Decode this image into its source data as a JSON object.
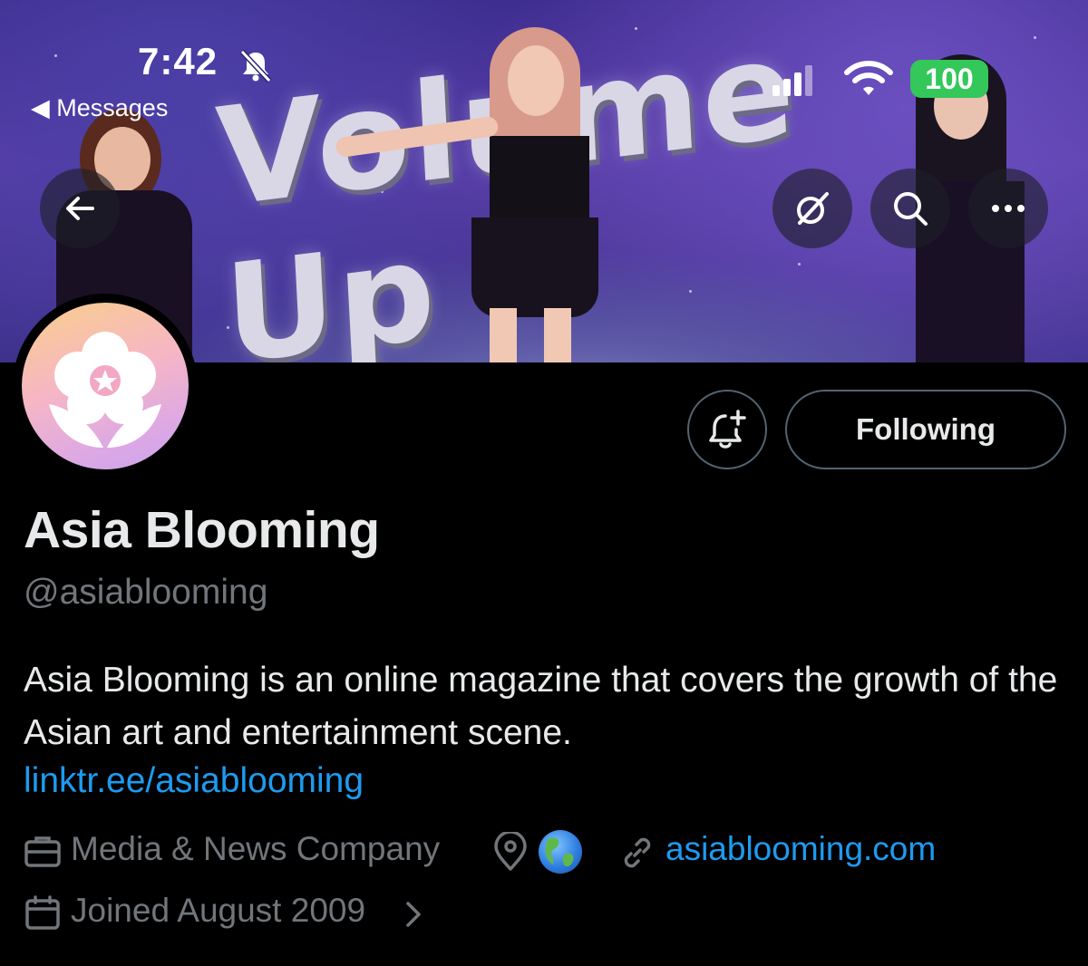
{
  "status_bar": {
    "time": "7:42",
    "back_app_label": "◀ Messages",
    "battery": "100",
    "battery_color": "#34c759"
  },
  "header": {
    "icons": [
      "arrow-left-icon",
      "grok-icon",
      "search-icon",
      "more-icon"
    ]
  },
  "banner": {
    "text": "Volume Up"
  },
  "profile": {
    "display_name": "Asia Blooming",
    "handle": "@asiablooming",
    "bio": "Asia Blooming is an online magazine that covers the growth of the Asian art and entertainment scene.",
    "bio_link": "linktr.ee/asiablooming",
    "category": "Media & News Company",
    "website": "asiablooming.com",
    "joined": "Joined August 2009",
    "following_label": "Following"
  },
  "colors": {
    "link": "#1d9bf0",
    "muted": "#71767b",
    "text": "#e7e9ea",
    "background": "#000000",
    "button_border": "#536471"
  }
}
